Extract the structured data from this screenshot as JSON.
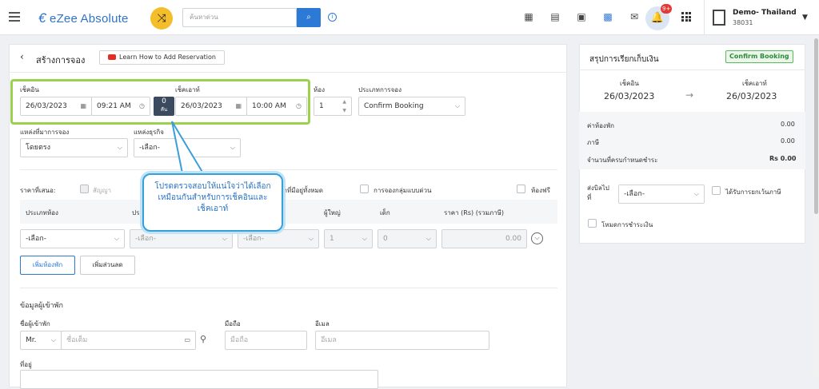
{
  "topbar": {
    "brand": "eZee Absolute",
    "search_placeholder": "ค้นหาด่วน",
    "notification_count": "9+",
    "user_name": "Demo- Thailand",
    "user_id": "38031"
  },
  "page": {
    "title": "สร้างการจอง",
    "learn_button": "Learn How to Add Reservation"
  },
  "booking": {
    "checkin_label": "เช็คอิน",
    "checkin_date": "26/03/2023",
    "checkin_time": "09:21 AM",
    "nights_value": "0",
    "nights_label": "คืน",
    "checkout_label": "เช็คเอาท์",
    "checkout_date": "26/03/2023",
    "checkout_time": "10:00 AM",
    "rooms_label": "ห้อง",
    "rooms_value": "1",
    "booking_type_label": "ประเภทการจอง",
    "booking_type_value": "Confirm Booking",
    "source_label": "แหล่งที่มาการจอง",
    "source_value": "โดยตรง",
    "business_source_label": "แหล่งธุรกิจ",
    "business_source_value": "-เลือก-"
  },
  "rates": {
    "offer_label": "ราคาที่เสนอ:",
    "contract_label": "สัญญา",
    "all_rooms_label": "งพักที่มีอยู่ทั้งหมด",
    "group_booking_label": "การจองกลุ่มแบบด่วน",
    "complimentary_label": "ห้องฟรี",
    "columns": [
      "ประเภทห้อง",
      "ประ",
      "ผู้ใหญ่",
      "เด็ก",
      "ราคา (Rs)  (รวมภาษี)"
    ],
    "room_type_value": "-เลือก-",
    "rate_type_value": "-เลือก-",
    "rate_value_2": "-เลือก-",
    "adults_value": "1",
    "children_value": "0",
    "price_value": "0.00",
    "add_room_button": "เพิ่มห้องพัก",
    "add_discount_button": "เพิ่มส่วนลด"
  },
  "guest": {
    "section_title": "ข้อมูลผู้เข้าพัก",
    "name_label": "ชื่อผู้เข้าพัก",
    "title_value": "Mr.",
    "name_placeholder": "ชื่อเต็ม",
    "mobile_label": "มือถือ",
    "mobile_placeholder": "มือถือ",
    "email_label": "อีเมล",
    "email_placeholder": "อีเมล",
    "address_label": "ที่อยู่"
  },
  "callout": {
    "text": "โปรดตรวจสอบให้แน่ใจว่าได้เลือกเหมือนกันสำหรับการเช็คอินและเช็คเอาท์"
  },
  "summary": {
    "title": "สรุปการเรียกเก็บเงิน",
    "status_badge": "Confirm Booking",
    "checkin_label": "เช็คอิน",
    "checkin_date": "26/03/2023",
    "arrow": "→",
    "checkout_label": "เช็คเอาท์",
    "checkout_date": "26/03/2023",
    "rows": [
      {
        "label": "ค่าห้องพัก",
        "value": "0.00"
      },
      {
        "label": "ภาษี",
        "value": "0.00"
      },
      {
        "label": "จำนวนที่ครบกำหนดชำระ",
        "value": "Rs 0.00"
      }
    ],
    "bill_to_label": "ส่งบิลไปที่",
    "bill_to_value": "-เลือก-",
    "tax_exempt_label": "ได้รับการยกเว้นภาษี",
    "payment_mode_label": "โหมดการชำระเงิน"
  },
  "colors": {
    "accent": "#2d7ad6",
    "highlight": "#9bd14e",
    "callout_border": "#3a9fd8",
    "badge_green": "#2e8b3b"
  }
}
